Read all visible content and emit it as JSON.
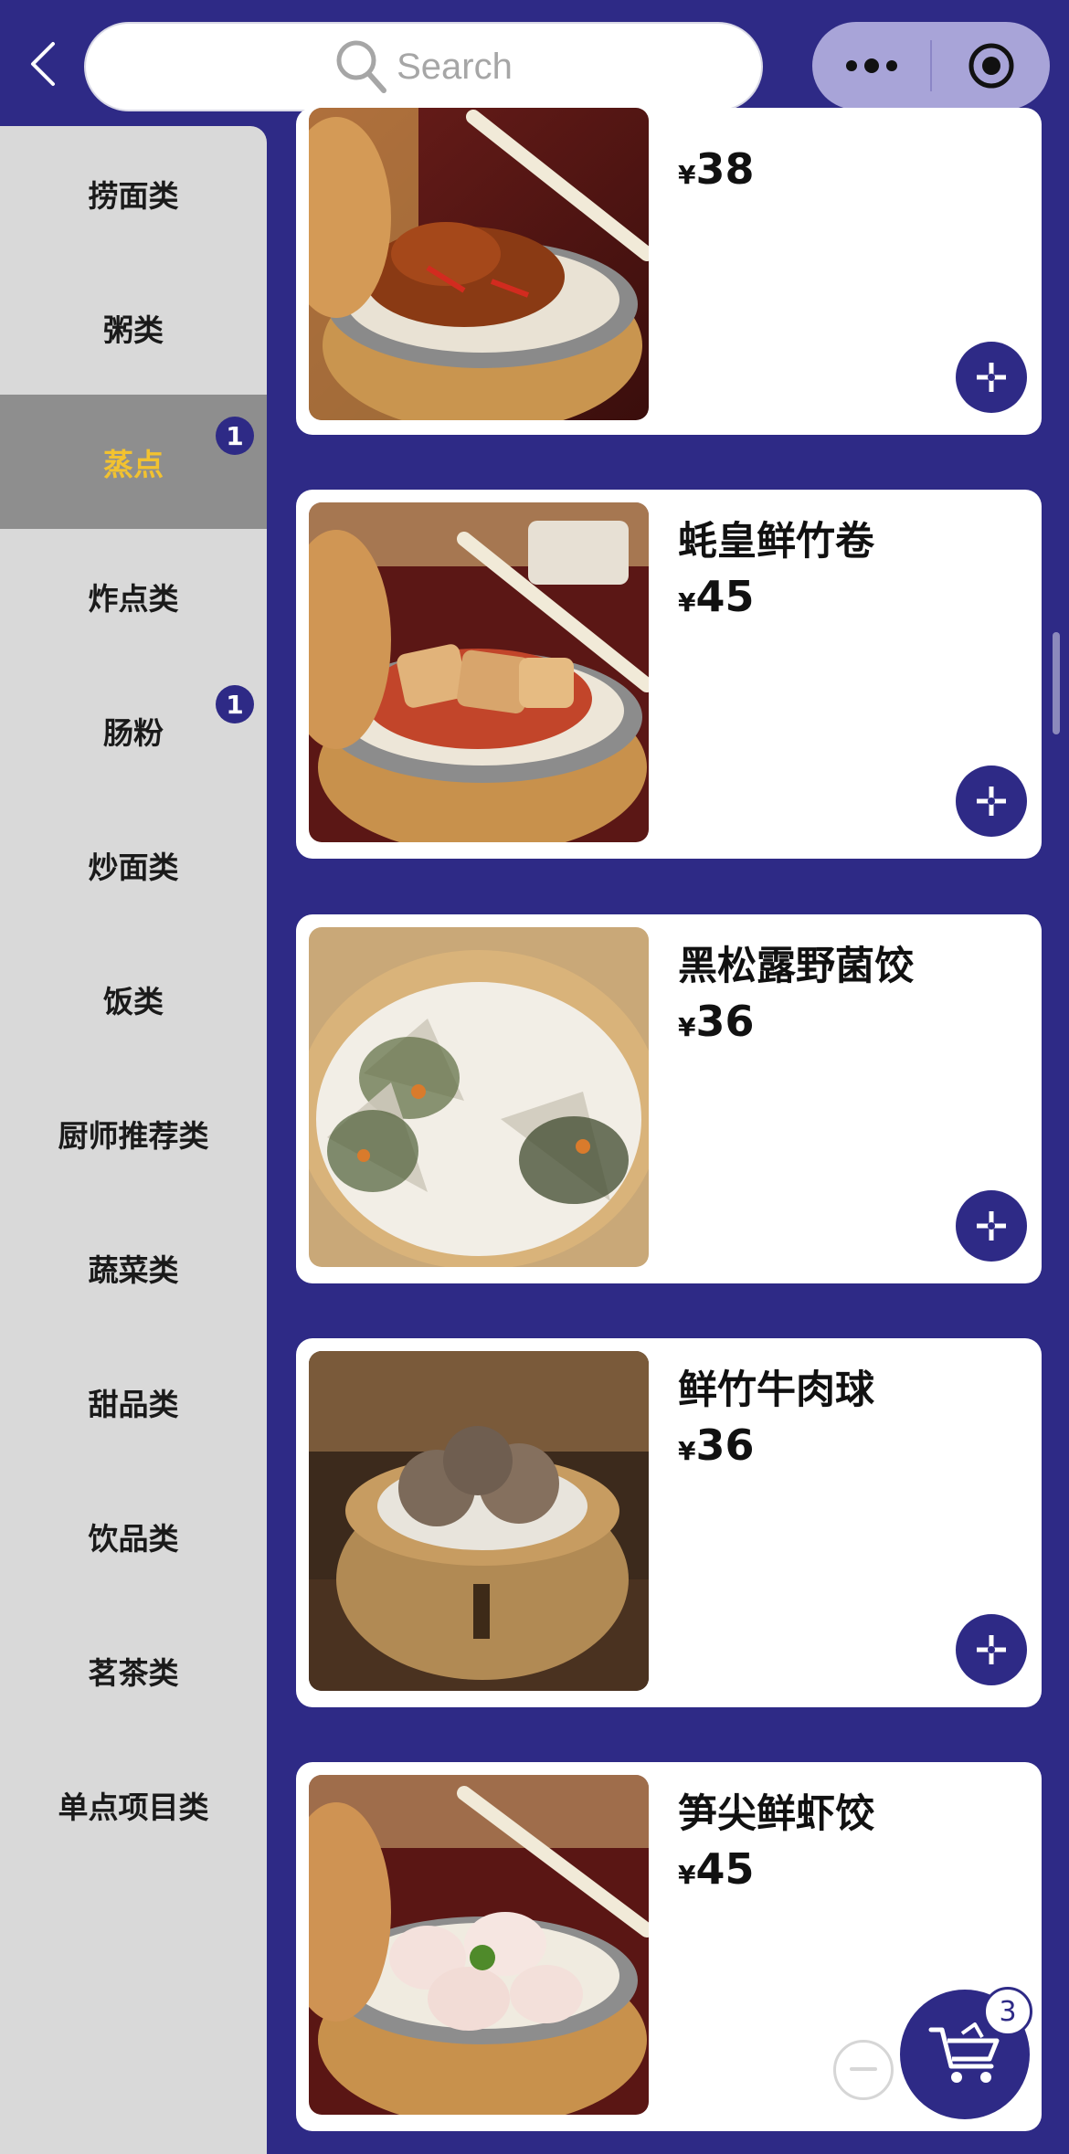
{
  "search": {
    "placeholder": "Search"
  },
  "colors": {
    "primary": "#2e2a86",
    "sidebar_bg": "#d9d9d9",
    "active_bg": "#8e8e8e",
    "active_text": "#f2c230",
    "capsule_bg": "#a8a4d8"
  },
  "categories": [
    {
      "label": "捞面类",
      "badge": ""
    },
    {
      "label": "粥类",
      "badge": ""
    },
    {
      "label": "蒸点",
      "badge": "1",
      "active": true
    },
    {
      "label": "炸点类",
      "badge": ""
    },
    {
      "label": "肠粉",
      "badge": "1"
    },
    {
      "label": "炒面类",
      "badge": ""
    },
    {
      "label": "饭类",
      "badge": ""
    },
    {
      "label": "厨师推荐类",
      "badge": ""
    },
    {
      "label": "蔬菜类",
      "badge": ""
    },
    {
      "label": "甜品类",
      "badge": ""
    },
    {
      "label": "饮品类",
      "badge": ""
    },
    {
      "label": "茗茶类",
      "badge": ""
    },
    {
      "label": "单点项目类",
      "badge": ""
    }
  ],
  "products": [
    {
      "name": "",
      "currency": "¥",
      "price": "38",
      "image": "spare-ribs-steamer-photo"
    },
    {
      "name": "蚝皇鲜竹卷",
      "currency": "¥",
      "price": "45",
      "image": "bean-curd-roll-steamer-photo"
    },
    {
      "name": "黑松露野菌饺",
      "currency": "¥",
      "price": "36",
      "image": "truffle-mushroom-dumpling-photo"
    },
    {
      "name": "鲜竹牛肉球",
      "currency": "¥",
      "price": "36",
      "image": "beef-ball-steamer-photo"
    },
    {
      "name": "笋尖鲜虾饺",
      "currency": "¥",
      "price": "45",
      "image": "shrimp-dumpling-steamer-photo"
    }
  ],
  "cart": {
    "count": "3"
  }
}
